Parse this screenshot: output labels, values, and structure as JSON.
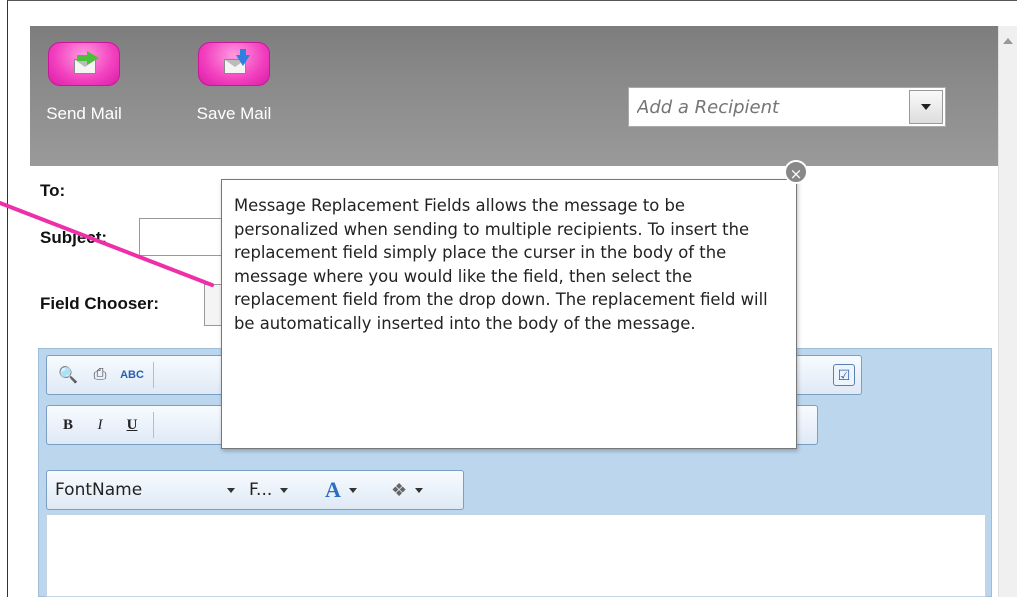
{
  "toolbar": {
    "send_label": "Send Mail",
    "save_label": "Save Mail",
    "recipient_placeholder": "Add a Recipient"
  },
  "form": {
    "to_label": "To:",
    "subject_label": "Subject:",
    "field_chooser_label": "Field Chooser:"
  },
  "editor": {
    "bold": "B",
    "italic": "I",
    "underline": "U",
    "font_name": "FontName",
    "font_size": "F...",
    "font_color_glyph": "A"
  },
  "tooltip": {
    "text": "Message Replacement Fields allows the message to be personalized when sending to multiple recipients. To insert the replacement field simply place the curser in the body of the message where you would like the field, then select the replacement field from the drop down. The replacement field will be automatically inserted into the body of the message.",
    "close_glyph": "×"
  },
  "colors": {
    "button_pink": "#f23fbf",
    "toolbar_gray": "#8a8a8a",
    "editor_blue": "#bcd6ee",
    "pointer_magenta": "#ee2fa8"
  },
  "icons": [
    "send-mail-icon",
    "save-mail-icon",
    "find-icon",
    "print-icon",
    "spellcheck-icon",
    "preview-icon",
    "font-color-icon",
    "highlight-icon",
    "close-icon"
  ]
}
